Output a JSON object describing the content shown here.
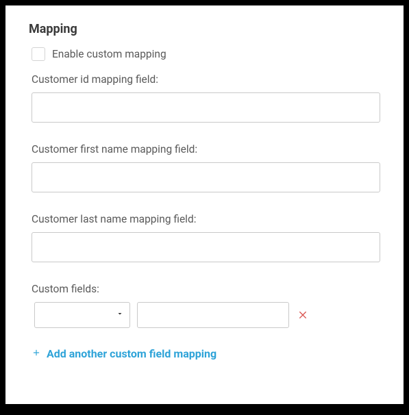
{
  "section": {
    "title": "Mapping"
  },
  "enable": {
    "label": "Enable custom mapping",
    "checked": false
  },
  "fields": {
    "customerId": {
      "label": "Customer id mapping field:",
      "value": ""
    },
    "firstName": {
      "label": "Customer first name mapping field:",
      "value": ""
    },
    "lastName": {
      "label": "Customer last name mapping field:",
      "value": ""
    }
  },
  "customFields": {
    "label": "Custom fields:",
    "rows": [
      {
        "selectValue": "",
        "textValue": ""
      }
    ]
  },
  "addLink": {
    "label": "Add another custom field mapping"
  },
  "colors": {
    "accent": "#2ea3d8",
    "danger": "#d9534f"
  }
}
